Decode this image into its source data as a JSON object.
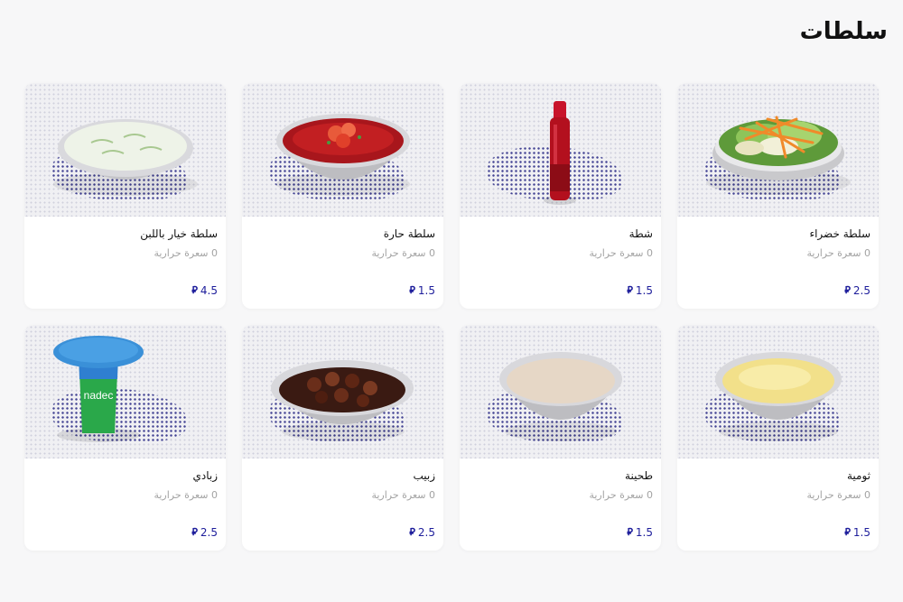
{
  "section": {
    "title": "سلطات"
  },
  "products": [
    {
      "name": "سلطة خضراء",
      "calories": "0 سعرة حرارية",
      "price": "2.5",
      "currency_symbol": "⃁",
      "image": "green-salad-bowl"
    },
    {
      "name": "شطة",
      "calories": "0 سعرة حرارية",
      "price": "1.5",
      "currency_symbol": "⃁",
      "image": "hot-sauce-bottle"
    },
    {
      "name": "سلطة حارة",
      "calories": "0 سعرة حرارية",
      "price": "1.5",
      "currency_symbol": "⃁",
      "image": "spicy-salad-bowl"
    },
    {
      "name": "سلطة خيار باللبن",
      "calories": "0 سعرة حرارية",
      "price": "4.5",
      "currency_symbol": "⃁",
      "image": "cucumber-yogurt-bowl"
    },
    {
      "name": "ثومية",
      "calories": "0 سعرة حرارية",
      "price": "1.5",
      "currency_symbol": "⃁",
      "image": "garlic-sauce-bowl"
    },
    {
      "name": "طحينة",
      "calories": "0 سعرة حرارية",
      "price": "1.5",
      "currency_symbol": "⃁",
      "image": "tahini-bowl"
    },
    {
      "name": "زبيب",
      "calories": "0 سعرة حرارية",
      "price": "2.5",
      "currency_symbol": "⃁",
      "image": "raisins-bowl"
    },
    {
      "name": "زبادي",
      "calories": "0 سعرة حرارية",
      "price": "2.5",
      "currency_symbol": "⃁",
      "image": "yogurt-cup",
      "image_text": "nadec"
    }
  ]
}
